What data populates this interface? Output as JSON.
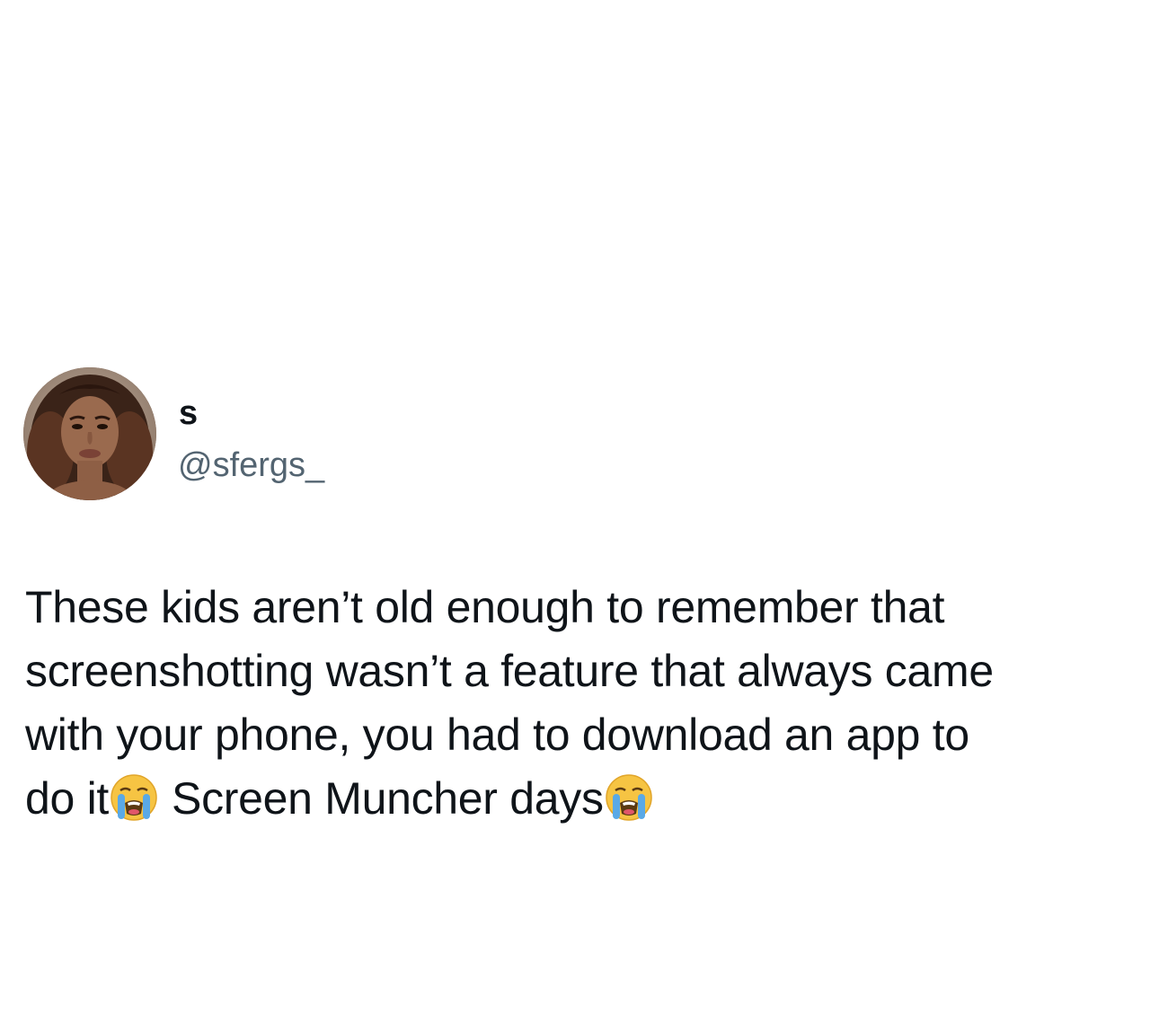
{
  "tweet": {
    "author": {
      "display_name": "s",
      "handle": "@sfergs_",
      "avatar_icon": "profile-photo"
    },
    "text_lines": [
      "These kids aren’t old enough to remember that",
      "screenshotting wasn’t a feature that always came",
      "with your phone, you had to download an app to",
      "do it",
      "Screen Muncher days"
    ],
    "emoji": "loudly-crying-face-emoji"
  },
  "colors": {
    "background": "#ffffff",
    "text_primary": "#0f1419",
    "text_secondary": "#536471"
  }
}
